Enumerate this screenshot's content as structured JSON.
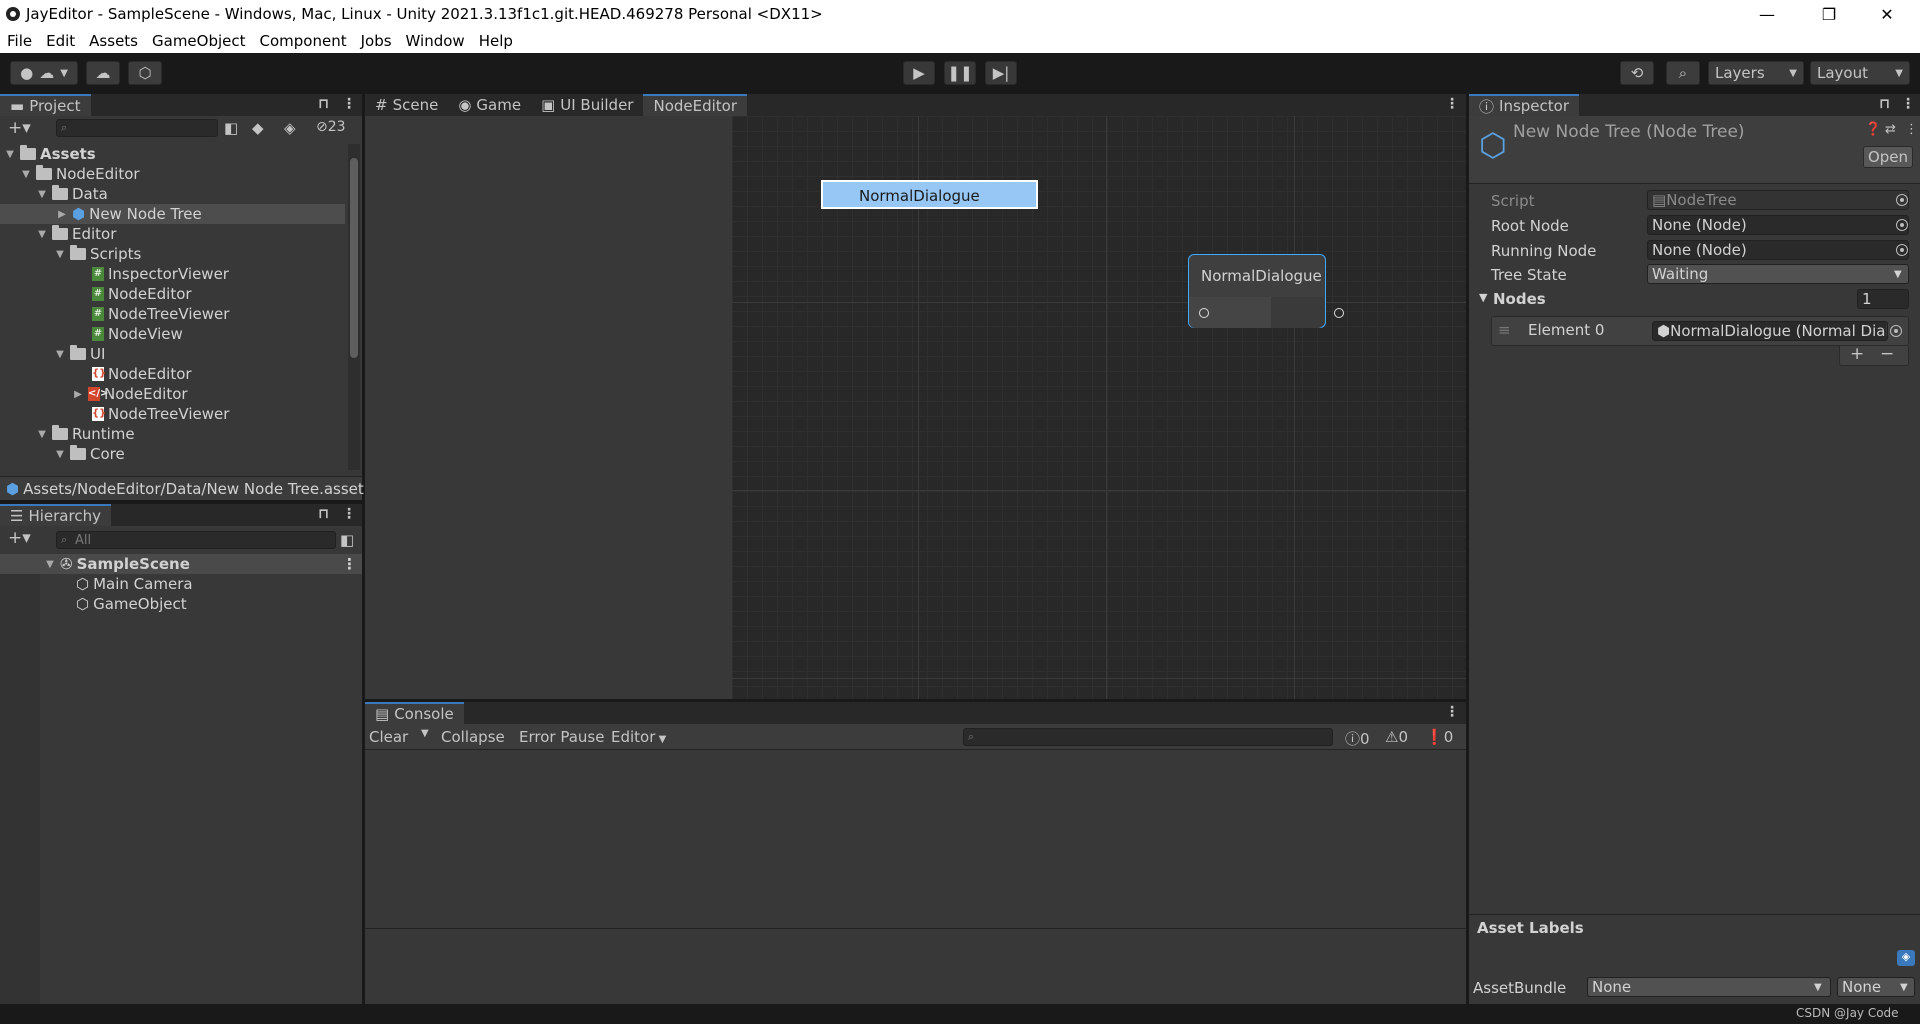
{
  "window": {
    "title": "JayEditor - SampleScene - Windows, Mac, Linux - Unity 2021.3.13f1c1.git.HEAD.469278 Personal <DX11>",
    "minimize": "—",
    "maximize": "❐",
    "close": "✕"
  },
  "menu": [
    "File",
    "Edit",
    "Assets",
    "GameObject",
    "Component",
    "Jobs",
    "Window",
    "Help"
  ],
  "toolbar": {
    "layers_label": "Layers",
    "layout_label": "Layout"
  },
  "project": {
    "tab_label": "Project",
    "hidden_count": "23",
    "tree": [
      {
        "label": "Assets",
        "depth": 0,
        "arrow": "▼",
        "icon": "folder"
      },
      {
        "label": "NodeEditor",
        "depth": 1,
        "arrow": "▼",
        "icon": "folder"
      },
      {
        "label": "Data",
        "depth": 2,
        "arrow": "▼",
        "icon": "folder"
      },
      {
        "label": "New Node Tree",
        "depth": 3,
        "arrow": "▶",
        "icon": "nodetree",
        "selected": true
      },
      {
        "label": "Editor",
        "depth": 2,
        "arrow": "▼",
        "icon": "folder"
      },
      {
        "label": "Scripts",
        "depth": 3,
        "arrow": "▼",
        "icon": "folder"
      },
      {
        "label": "InspectorViewer",
        "depth": 4,
        "arrow": "",
        "icon": "cs"
      },
      {
        "label": "NodeEditor",
        "depth": 4,
        "arrow": "",
        "icon": "cs"
      },
      {
        "label": "NodeTreeViewer",
        "depth": 4,
        "arrow": "",
        "icon": "cs"
      },
      {
        "label": "NodeView",
        "depth": 4,
        "arrow": "",
        "icon": "cs"
      },
      {
        "label": "UI",
        "depth": 3,
        "arrow": "▼",
        "icon": "folder"
      },
      {
        "label": "NodeEditor",
        "depth": 4,
        "arrow": "",
        "icon": "uxml"
      },
      {
        "label": "NodeEditor",
        "depth": 4,
        "arrow": "▶",
        "icon": "uss"
      },
      {
        "label": "NodeTreeViewer",
        "depth": 4,
        "arrow": "",
        "icon": "uxml"
      },
      {
        "label": "Runtime",
        "depth": 2,
        "arrow": "▼",
        "icon": "folder"
      },
      {
        "label": "Core",
        "depth": 3,
        "arrow": "▼",
        "icon": "folder"
      }
    ],
    "path": "Assets/NodeEditor/Data/New Node Tree.asset"
  },
  "hierarchy": {
    "tab_label": "Hierarchy",
    "search_placeholder": "All",
    "scene": "SampleScene",
    "items": [
      "Main Camera",
      "GameObject"
    ]
  },
  "center_tabs": [
    {
      "label": "Scene",
      "icon": "#"
    },
    {
      "label": "Game",
      "icon": "◉"
    },
    {
      "label": "UI Builder",
      "icon": "▣"
    },
    {
      "label": "NodeEditor",
      "icon": "",
      "active": true
    }
  ],
  "node_editor": {
    "tree_item": "NormalDialogue",
    "node_title": "NormalDialogue"
  },
  "console": {
    "tab_label": "Console",
    "clear": "Clear",
    "collapse": "Collapse",
    "error_pause": "Error Pause",
    "editor": "Editor",
    "info_count": "0",
    "warn_count": "0",
    "error_count": "0"
  },
  "inspector": {
    "tab_label": "Inspector",
    "title": "New Node Tree (Node Tree)",
    "open_button": "Open",
    "fields": {
      "script_label": "Script",
      "script_value": "NodeTree",
      "root_label": "Root Node",
      "root_value": "None (Node)",
      "running_label": "Running Node",
      "running_value": "None (Node)",
      "state_label": "Tree State",
      "state_value": "Waiting",
      "nodes_label": "Nodes",
      "nodes_count": "1",
      "element_label": "Element 0",
      "element_value": "NormalDialogue (Normal Dialogue)"
    },
    "plus": "+",
    "minus": "−",
    "asset_labels": "Asset Labels",
    "assetbundle_label": "AssetBundle",
    "assetbundle_value": "None",
    "variant_value": "None"
  },
  "watermark": "CSDN @Jay Code"
}
